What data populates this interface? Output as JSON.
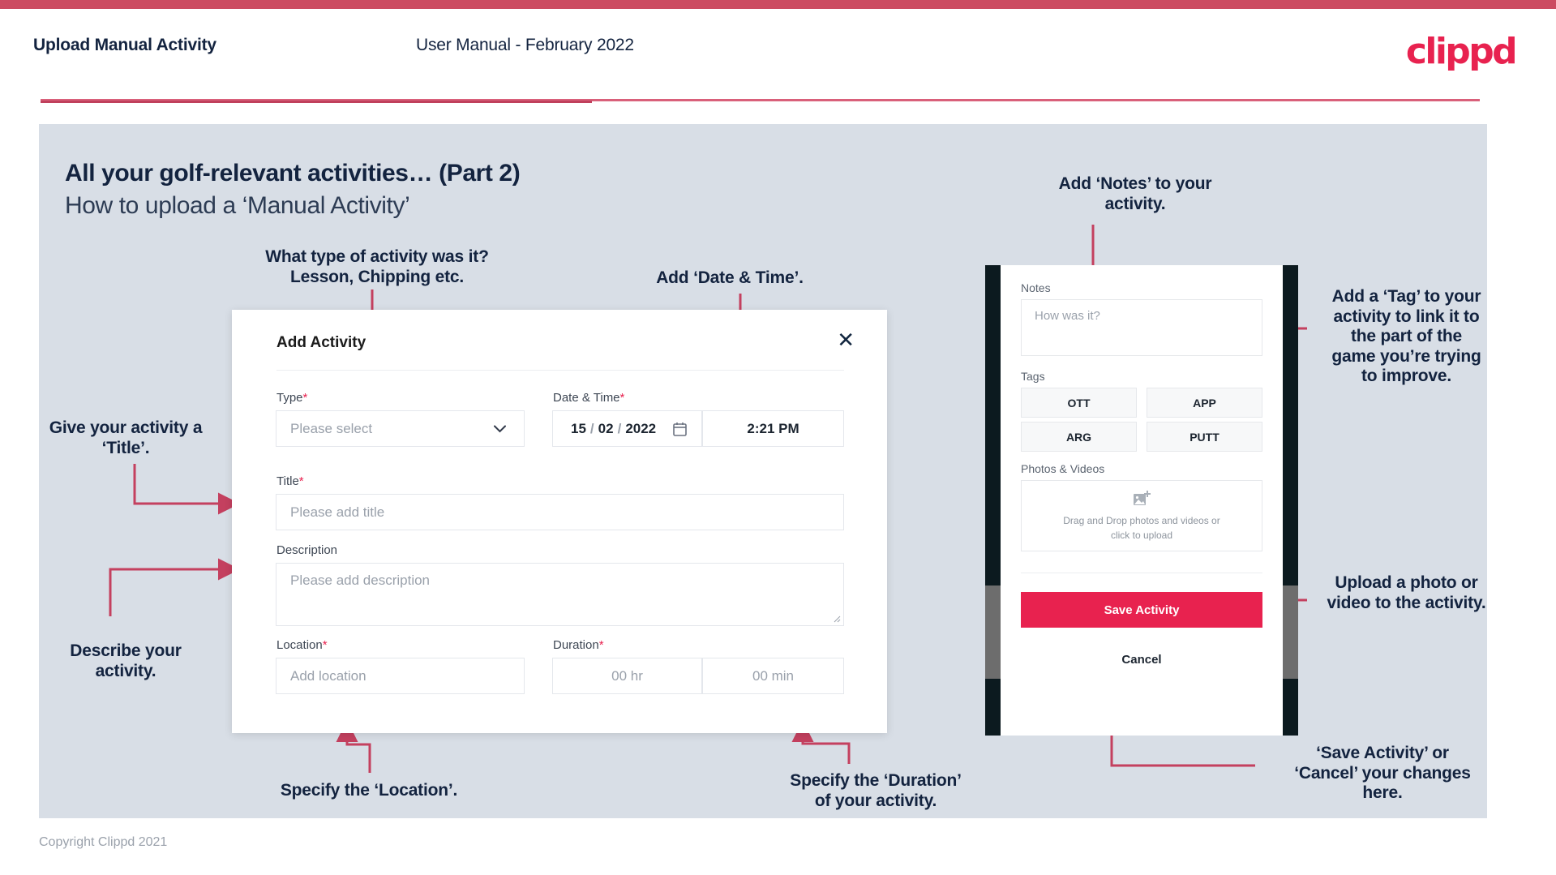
{
  "header": {
    "title": "Upload Manual Activity",
    "subtitle": "User Manual - February 2022",
    "logo": "clippd"
  },
  "panel": {
    "heading_bold": "All your golf-relevant activities… (Part 2)",
    "heading_light": "How to upload a ‘Manual Activity’"
  },
  "dialog": {
    "title": "Add Activity",
    "close_icon": "✕",
    "fields": {
      "type_label": "Type",
      "type_placeholder": "Please select",
      "datetime_label": "Date & Time",
      "date_day": "15",
      "date_sep1": "/",
      "date_month": "02",
      "date_sep2": "/",
      "date_year": "2022",
      "time_value": "2:21 PM",
      "title_label": "Title",
      "title_placeholder": "Please add title",
      "description_label": "Description",
      "description_placeholder": "Please add description",
      "location_label": "Location",
      "location_placeholder": "Add location",
      "duration_label": "Duration",
      "duration_hr_placeholder": "00 hr",
      "duration_min_placeholder": "00 min"
    },
    "required_marker": "*"
  },
  "phone": {
    "notes_label": "Notes",
    "notes_placeholder": "How was it?",
    "tags_label": "Tags",
    "tags": [
      "OTT",
      "APP",
      "ARG",
      "PUTT"
    ],
    "photos_label": "Photos & Videos",
    "drop_line1": "Drag and Drop photos and videos or",
    "drop_line2": "click to upload",
    "save_label": "Save Activity",
    "cancel_label": "Cancel"
  },
  "annotations": {
    "type": "What type of activity was it?\nLesson, Chipping etc.",
    "datetime": "Add ‘Date & Time’.",
    "title": "Give your activity a\n‘Title’.",
    "description": "Describe your\nactivity.",
    "location": "Specify the ‘Location’.",
    "duration": "Specify the ‘Duration’\nof your activity.",
    "notes": "Add ‘Notes’ to your\nactivity.",
    "tags": "Add a ‘Tag’ to your\nactivity to link it to\nthe part of the\ngame you’re trying\nto improve.",
    "upload": "Upload a photo or\nvideo to the activity.",
    "savecancel": "‘Save Activity’ or\n‘Cancel’ your changes\nhere."
  },
  "footer": {
    "copyright": "Copyright Clippd 2021"
  },
  "colors": {
    "accent": "#e8224f",
    "top_bar": "#cc4b61",
    "panel_bg": "#d8dee6",
    "ink": "#13233f",
    "connector": "#c4405f"
  }
}
